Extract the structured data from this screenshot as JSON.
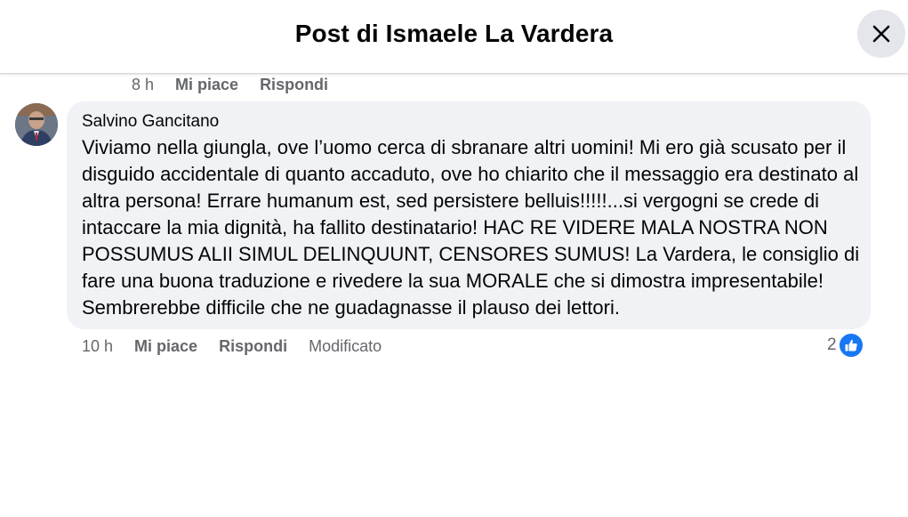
{
  "header": {
    "title": "Post di Ismaele La Vardera",
    "close_icon": "close-icon"
  },
  "previous_comment_actions": {
    "time": "8 h",
    "like_label": "Mi piace",
    "reply_label": "Rispondi"
  },
  "comment": {
    "author": "Salvino Gancitano",
    "text": "Viviamo nella giungla, ove l’uomo cerca di sbranare altri uomini! Mi ero già scusato per il disguido accidentale di quanto accaduto, ove ho chiarito che il messaggio era destinato al altra persona! Errare humanum est, sed persistere belluis!!!!!...si vergogni se crede di intaccare la mia dignità, ha fallito destinatario! HAC RE VIDERE MALA NOSTRA NON POSSUMUS ALII SIMUL DELINQUUNT, CENSORES SUMUS! La Vardera, le consiglio di fare una buona traduzione e rivedere la sua MORALE che si dimostra impresentabile! Sembrerebbe difficile che ne guadagnasse il plauso dei lettori.",
    "time": "10 h",
    "like_label": "Mi piace",
    "reply_label": "Rispondi",
    "edited_label": "Modificato",
    "reaction_count": "2",
    "reaction_icon": "thumbs-up-icon"
  },
  "colors": {
    "accent": "#1877f2",
    "secondary_text": "#65676b",
    "bubble_bg": "#f0f2f5",
    "close_bg": "#e4e6eb"
  }
}
